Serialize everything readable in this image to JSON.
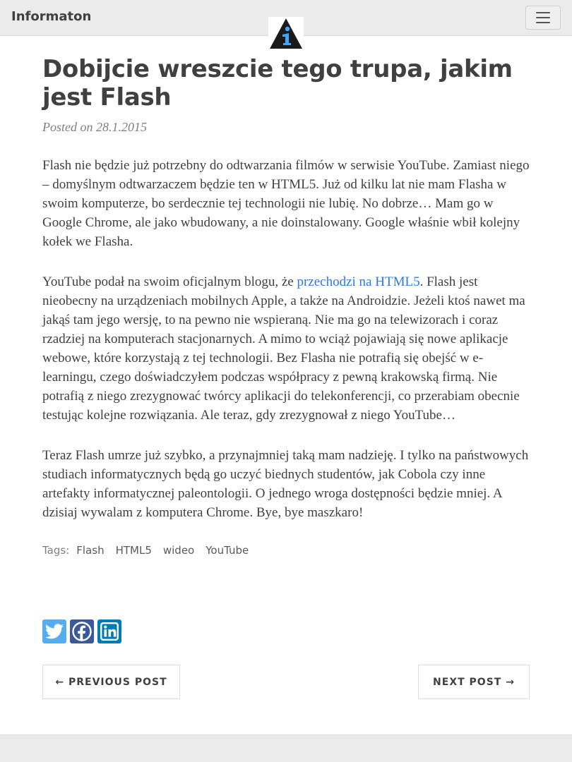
{
  "navbar": {
    "brand": "Informaton",
    "logo_icon": "info-triangle-icon",
    "menu_icon": "hamburger-icon"
  },
  "post": {
    "title": "Dobijcie wreszcie tego trupa, jakim jest Flash",
    "meta": "Posted on 28.1.2015",
    "p1": "Flash nie będzie już potrzebny do odtwarzania filmów w serwisie YouTube. Zamiast niego – domyślnym odtwarzaczem będzie ten w HTML5. Już od kilku lat nie mam Flasha w swoim komputerze, bo serdecznie tej technologii nie lubię. No dobrze… Mam go w Google Chrome, ale jako wbudowany, a nie doinstalowany. Google właśnie wbił kolejny kołek we Flasha.",
    "p2_before": "YouTube podał na swoim oficjalnym blogu, że ",
    "p2_link": "przechodzi na HTML5",
    "p2_after": ". Flash jest nieobecny na urządzeniach mobilnych Apple, a także na Androidzie. Jeżeli ktoś nawet ma jakąś tam jego wersję, to na pewno nie wspieraną. Nie ma go na telewizorach i coraz rzadziej na komputerach stacjonarnych. A mimo to wciąż pojawiają się nowe aplikacje webowe, które korzystają z tej technologii. Bez Flasha nie potrafią się obejść w e-learningu, czego doświadczyłem podczas współpracy z pewną krakowską firmą. Nie potrafią z niego zrezygnować twórcy aplikacji do telekonferencji, co przerabiam obecnie testując kolejne rozwiązania. Ale teraz, gdy zrezygnował z niego YouTube…",
    "p3": "Teraz Flash umrze już szybko, a przynajmniej taką mam nadzieję. I tylko na państwowych studiach informatycznych będą go uczyć biednych studentów, jak Cobola czy inne artefakty informatycznej paleontologii. O jednego wroga dostępności będzie mniej. A dzisiaj wywalam z komputera Chrome. Bye, bye maszkaro!"
  },
  "tags": {
    "label": "Tags:",
    "items": [
      "Flash",
      "HTML5",
      "wideo",
      "YouTube"
    ]
  },
  "share": {
    "icons": [
      "twitter-icon",
      "facebook-icon",
      "linkedin-icon"
    ],
    "colors": {
      "twitter": "#55acee",
      "facebook": "#3b5998",
      "linkedin": "#007bb5"
    }
  },
  "pager": {
    "previous": "← PREVIOUS POST",
    "next": "NEXT POST →"
  }
}
